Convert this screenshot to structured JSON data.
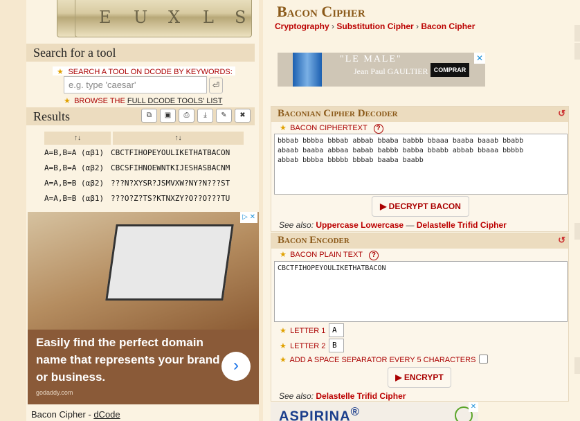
{
  "logo_letters": [
    "E",
    "U",
    "X",
    "L",
    "S"
  ],
  "search": {
    "title": "Search for a tool",
    "label": "SEARCH A TOOL ON DCODE BY KEYWORDS:",
    "placeholder": "e.g. type 'caesar'",
    "go_icon": "⏎",
    "browse_prefix": "BROWSE THE ",
    "browse_link": "FULL DCODE TOOLS' LIST"
  },
  "results": {
    "title": "Results",
    "tool_buttons": [
      "copy-icon",
      "copy-all-icon",
      "print-icon",
      "download-icon",
      "pin-icon",
      "close-icon"
    ],
    "tool_glyphs": [
      "⧉",
      "▣",
      "⎙",
      "⤓",
      "✎",
      "✖"
    ],
    "headers": [
      "↑↓",
      "↑↓"
    ],
    "rows": [
      {
        "key": "A=B,B=A (αβ1)",
        "value": "CBCTFIHOPEYOULIKETHATBACON"
      },
      {
        "key": "A=B,B=A (αβ2)",
        "value": "CBCSFIHNOEWNTKIJESHASBACNM"
      },
      {
        "key": "A=A,B=B (αβ2)",
        "value": "???N?XYSR?JSMVXW?NY?N???ST"
      },
      {
        "key": "A=A,B=B (αβ1)",
        "value": "???O?Z?TS?KTNXZY?O??O???TU"
      }
    ]
  },
  "ad_left": {
    "headline": "Easily find the perfect domain name that represents your brand or business.",
    "domain": "godaddy.com",
    "arrow": "›",
    "choice": "▷ ✕"
  },
  "footer": {
    "prefix": "Bacon Cipher - ",
    "link": "dCode"
  },
  "page": {
    "title": "Bacon Cipher",
    "breadcrumb": [
      "Cryptography",
      "Substitution Cipher",
      "Bacon Cipher"
    ],
    "breadcrumb_sep": "›"
  },
  "ad_top": {
    "brand": "\"LE MALE\"",
    "sub": "Jean Paul GAULTIER",
    "buy": "COMPRAR",
    "close": "✕"
  },
  "decoder": {
    "title": "Baconian Cipher Decoder",
    "refresh": "↺",
    "label": "BACON CIPHERTEXT",
    "help": "?",
    "ciphertext": "bbbab bbbba bbbab abbab bbaba babbb bbaaa baaba baaab bbabb\nabaab baaba abbaa babab babbb babba bbabb abbab bbaaa bbbbb\nabbab bbbba bbbbb bbbab baaba baabb",
    "button": "▶ DECRYPT BACON",
    "see_also_label": "See also: ",
    "see_also": [
      "Uppercase Lowercase",
      "Delastelle Trifid Cipher"
    ],
    "see_also_sep": " — "
  },
  "encoder": {
    "title": "Bacon Encoder",
    "refresh": "↺",
    "label": "BACON PLAIN TEXT",
    "help": "?",
    "plaintext": "CBCTFIHOPEYOULIKETHATBACON",
    "letter1_label": "LETTER 1",
    "letter1_value": "A",
    "letter2_label": "LETTER 2",
    "letter2_value": "B",
    "separator_label": "ADD A SPACE SEPARATOR EVERY 5 CHARACTERS",
    "separator_checked": false,
    "button": "▶ ENCRYPT",
    "see_also_label": "See also: ",
    "see_also": [
      "Delastelle Trifid Cipher"
    ]
  },
  "ad_bottom": {
    "brand": "ASPIRINA",
    "sup": "®",
    "close": "✕"
  },
  "colors": {
    "accent_red": "#aa0000",
    "title_brown": "#8b5a1a",
    "panel_header": "#ecdcbf",
    "background": "#fbf3e2",
    "star": "#e0a100"
  }
}
